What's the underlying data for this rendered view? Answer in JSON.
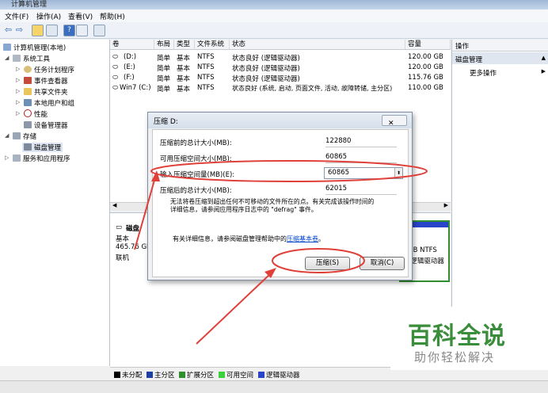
{
  "window": {
    "title": "计算机管理"
  },
  "menu": [
    "文件(F)",
    "操作(A)",
    "查看(V)",
    "帮助(H)"
  ],
  "tree": {
    "root": "计算机管理(本地)",
    "items": [
      {
        "label": "系统工具",
        "level": 1,
        "icon": "tools-icon"
      },
      {
        "label": "任务计划程序",
        "level": 2,
        "icon": "clock-icon"
      },
      {
        "label": "事件查看器",
        "level": 2,
        "icon": "event-viewer-icon"
      },
      {
        "label": "共享文件夹",
        "level": 2,
        "icon": "shared-folder-icon"
      },
      {
        "label": "本地用户和组",
        "level": 2,
        "icon": "users-icon"
      },
      {
        "label": "性能",
        "level": 2,
        "icon": "performance-icon"
      },
      {
        "label": "设备管理器",
        "level": 2,
        "icon": "device-manager-icon"
      },
      {
        "label": "存储",
        "level": 1,
        "icon": "storage-icon"
      },
      {
        "label": "磁盘管理",
        "level": 2,
        "icon": "disk-management-icon"
      },
      {
        "label": "服务和应用程序",
        "level": 1,
        "icon": "services-icon"
      }
    ]
  },
  "volumes": {
    "headers": [
      "卷",
      "布局",
      "类型",
      "文件系统",
      "状态",
      "容量"
    ],
    "rows": [
      [
        "(D:)",
        "简单",
        "基本",
        "NTFS",
        "状态良好 (逻辑驱动器)",
        "120.00 GB"
      ],
      [
        "(E:)",
        "简单",
        "基本",
        "NTFS",
        "状态良好 (逻辑驱动器)",
        "120.00 GB"
      ],
      [
        "(F:)",
        "简单",
        "基本",
        "NTFS",
        "状态良好 (逻辑驱动器)",
        "115.76 GB"
      ],
      [
        "Win7 (C:)",
        "简单",
        "基本",
        "NTFS",
        "状态良好 (系统, 启动, 页面文件, 活动, 故障转储, 主分区)",
        "110.00 GB"
      ]
    ]
  },
  "actions": {
    "header": "操作",
    "section": "磁盘管理",
    "more": "更多操作"
  },
  "disk": {
    "name": "磁盘",
    "type": "基本",
    "size": "465.76 GB",
    "status": "联机",
    "right_fs": "GB NTFS",
    "right_status": "(逻辑驱动器"
  },
  "legend": [
    {
      "label": "未分配",
      "color": "#000000"
    },
    {
      "label": "主分区",
      "color": "#1f3fa8"
    },
    {
      "label": "扩展分区",
      "color": "#2f8f2f"
    },
    {
      "label": "可用空间",
      "color": "#3cd03c"
    },
    {
      "label": "逻辑驱动器",
      "color": "#2844c8"
    }
  ],
  "dialog": {
    "title": "压缩 D:",
    "close": "✕",
    "fields": [
      {
        "label": "压缩前的总计大小(MB):",
        "value": "122880"
      },
      {
        "label": "可用压缩空间大小(MB):",
        "value": "60865"
      },
      {
        "label": "输入压缩空间量(MB)(E):",
        "value": "60865"
      },
      {
        "label": "压缩后的总计大小(MB):",
        "value": "62015"
      }
    ],
    "note": "无法将卷压缩到超出任何不可移动的文件所在的点。有关完成该操作时间的详细信息，请参阅应用程序日志中的 \"defrag\" 事件。",
    "note_line1": "无法将卷压缩到超出任何不可移动的文件所在的点。有关完成该操作时间的",
    "note_line2": "详细信息，请参阅应用程序日志中的 \"defrag\" 事件。",
    "info_prefix": "有关详细信息，请参阅磁盘管理帮助中的",
    "info_link": "压缩基本卷",
    "info_suffix": "。",
    "compress": "压缩(S)",
    "cancel": "取消(C)"
  },
  "watermark": {
    "logo": "百科全说",
    "sub": "助你轻松解决"
  },
  "colors": {
    "annotation": "#e0403a",
    "link": "#0044cc"
  }
}
